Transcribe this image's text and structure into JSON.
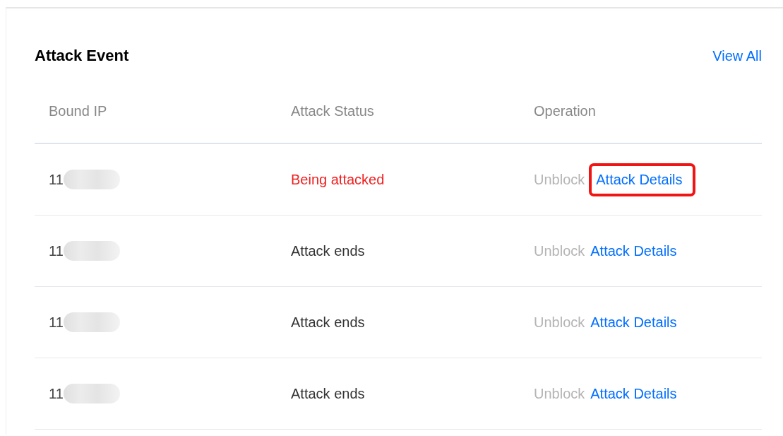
{
  "card": {
    "title": "Attack Event",
    "view_all": "View All"
  },
  "table": {
    "columns": [
      "Bound IP",
      "Attack Status",
      "Operation"
    ],
    "rows": [
      {
        "ip": "11",
        "status": "Being attacked",
        "color": "#f01e1e",
        "unblock": "Unblock",
        "unblock_disabled": true,
        "details": "Attack Details",
        "highlighted": true
      },
      {
        "ip": "11",
        "status": "Attack ends",
        "color": "#333333",
        "unblock": "Unblock",
        "unblock_disabled": true,
        "details": "Attack Details",
        "highlighted": false
      },
      {
        "ip": "11",
        "status": "Attack ends",
        "color": "#333333",
        "unblock": "Unblock",
        "unblock_disabled": true,
        "details": "Attack Details",
        "highlighted": false
      },
      {
        "ip": "11",
        "status": "Attack ends",
        "color": "#333333",
        "unblock": "Unblock",
        "unblock_disabled": true,
        "details": "Attack Details",
        "highlighted": false
      }
    ]
  }
}
